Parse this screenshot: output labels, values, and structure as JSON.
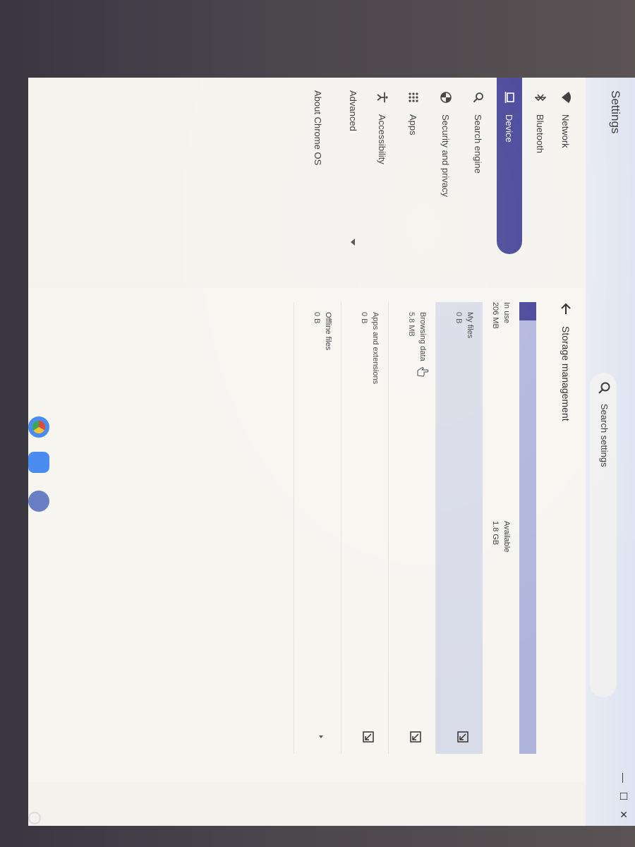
{
  "window": {
    "title": "Settings",
    "minimize": "—",
    "maximize": "☐",
    "close": "✕"
  },
  "search": {
    "placeholder": "Search settings"
  },
  "sidebar": {
    "items": [
      {
        "label": "Network",
        "icon": "wifi-icon"
      },
      {
        "label": "Bluetooth",
        "icon": "bluetooth-icon"
      },
      {
        "label": "Device",
        "icon": "laptop-icon",
        "selected": true
      },
      {
        "label": "Search engine",
        "icon": "search-icon"
      },
      {
        "label": "Security and privacy",
        "icon": "shield-icon"
      },
      {
        "label": "Apps",
        "icon": "apps-grid-icon"
      },
      {
        "label": "Accessibility",
        "icon": "accessibility-icon"
      }
    ],
    "advanced": "Advanced",
    "about": "About Chrome OS"
  },
  "storage": {
    "title": "Storage management",
    "in_use_label": "In use",
    "in_use_value": "206 MB",
    "available_label": "Available",
    "available_value": "1.8 GB",
    "usage_fraction": 0.04,
    "rows": [
      {
        "label": "My files",
        "value": "0 B"
      },
      {
        "label": "Browsing data",
        "value": "5.8 MB"
      },
      {
        "label": "Apps and extensions",
        "value": "0 B"
      },
      {
        "label": "Offline files",
        "value": "0 B"
      }
    ]
  },
  "colors": {
    "accent": "#3e3e94",
    "bar_empty": "#aeb4dc"
  }
}
